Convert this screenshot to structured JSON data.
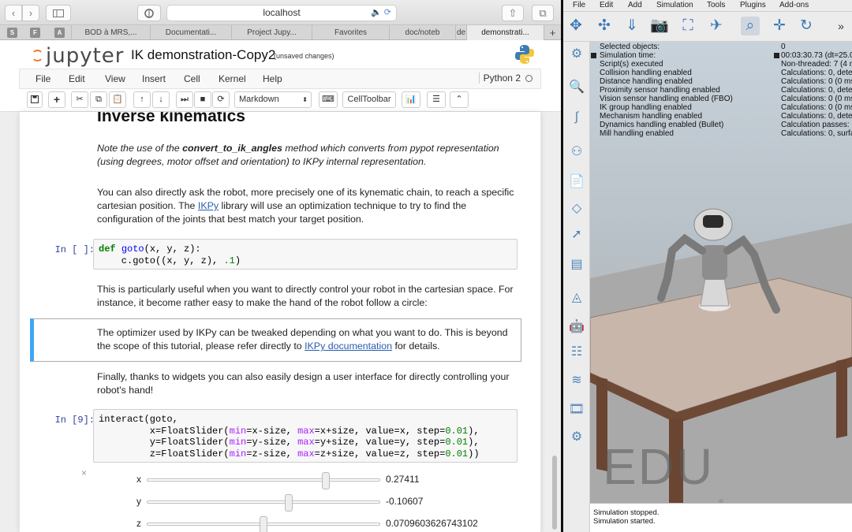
{
  "browser": {
    "address": "localhost",
    "tabs": [
      "BOD à MRS,...",
      "Documentati...",
      "Project Jupy...",
      "Favorites",
      "doc/noteb",
      "de",
      "demonstrati..."
    ],
    "favicons": [
      "S",
      "F",
      "A"
    ],
    "new_tab": "+"
  },
  "jupyter": {
    "logo_text": "jupyter",
    "title": "IK demonstration-Copy2",
    "status": "(unsaved changes)",
    "menus": [
      "File",
      "Edit",
      "View",
      "Insert",
      "Cell",
      "Kernel",
      "Help"
    ],
    "kernel": "Python 2",
    "toolbar": {
      "celltype": "Markdown",
      "celltoolbar": "CellToolbar"
    }
  },
  "notebook": {
    "heading": "Inverse kinematics",
    "p1_pre": "Note the use of the ",
    "p1_bold": "convert_to_ik_angles",
    "p1_post": " method which converts from pypot representation (using degrees, motor offset and orientation) to IKPy internal representation.",
    "p2_pre": "You can also directly ask the robot, more precisely one of its kynematic chain, to reach a specific cartesian position. The ",
    "p2_link": "IKPy",
    "p2_post": " library will use an optimization technique to try to find the configuration of the joints that best match your target position.",
    "prompt1": "In [ ]:",
    "p3": "This is particularly useful when you want to directly control your robot in the cartesian space. For instance, it become rather easy to make the hand of the robot follow a circle:",
    "p4_pre": "The optimizer used by IKPy can be tweaked depending on what you want to do. This is beyond the scope of this tutorial, please refer directly to ",
    "p4_link": "IKPy documentation",
    "p4_post": " for details.",
    "p5": "Finally, thanks to widgets you can also easily design a user interface for directly controlling your robot's hand!",
    "prompt2": "In [9]:",
    "close_x": "×",
    "sliders": [
      {
        "label": "x",
        "value": "0.27411",
        "level": 0.77
      },
      {
        "label": "y",
        "value": "-0.10607",
        "level": 0.61
      },
      {
        "label": "z",
        "value": "0.0709603626743102",
        "level": 0.5
      }
    ]
  },
  "vrep": {
    "menus": [
      "File",
      "Edit",
      "Add",
      "Simulation",
      "Tools",
      "Plugins",
      "Add-ons"
    ],
    "info_left": [
      "Selected objects:",
      "Simulation time:",
      "Script(s) executed",
      "Collision handling enabled",
      "Distance handling enabled",
      "Proximity sensor handling enabled",
      "Vision sensor handling enabled (FBO)",
      "IK group handling enabled",
      "Mechanism handling enabled",
      "Dynamics handling enabled (Bullet)",
      "Mill handling enabled"
    ],
    "info_right": [
      "0",
      "00:03:30.73 (dt=25.0",
      "Non-threaded: 7 (4 n",
      "Calculations: 0, dete",
      "Calculations: 0 (0 ms",
      "Calculations: 0, dete",
      "Calculations: 0 (0 ms",
      "Calculations: 0 (0 ms",
      "Calculations: 0, dete",
      "Calculation passes: ",
      "Calculations: 0, surfa"
    ],
    "watermark": "EDU",
    "console": [
      "Simulation stopped.",
      "Simulation started."
    ]
  }
}
